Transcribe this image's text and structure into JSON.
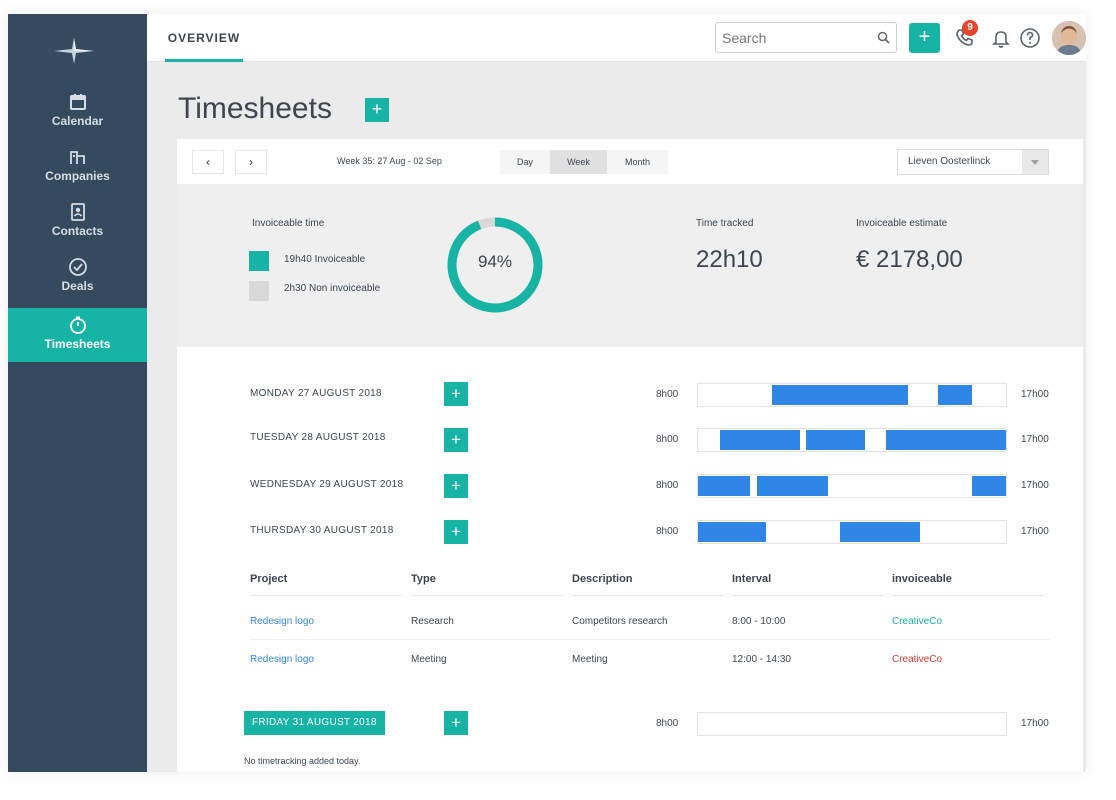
{
  "sidebar": {
    "items": [
      {
        "label": "Calendar",
        "icon": "calendar-icon"
      },
      {
        "label": "Companies",
        "icon": "companies-icon"
      },
      {
        "label": "Contacts",
        "icon": "contacts-icon"
      },
      {
        "label": "Deals",
        "icon": "deals-icon"
      },
      {
        "label": "Timesheets",
        "icon": "stopwatch-icon",
        "active": true
      }
    ]
  },
  "topbar": {
    "tab": "OVERVIEW",
    "search_placeholder": "Search",
    "notifications_count": "9"
  },
  "page": {
    "title": "Timesheets"
  },
  "toolbar": {
    "prev": "‹",
    "next": "›",
    "week_label": "Week 35: 27 Aug - 02 Sep",
    "views": [
      "Day",
      "Week",
      "Month"
    ],
    "active_view": "Week",
    "person": "Lieven Oosterlinck"
  },
  "stats": {
    "invoiceable_time_label": "Invoiceable time",
    "invoiceable": "19h40 Invoiceable",
    "non_invoiceable": "2h30 Non invoiceable",
    "percent_label": "94%",
    "percent_value": 0.94,
    "time_tracked_label": "Time tracked",
    "time_tracked": "22h10",
    "estimate_label": "Invoiceable estimate",
    "estimate": "€ 2178,00",
    "colors": {
      "invoiceable": "#17b3a5",
      "non_invoiceable": "#d8d8d8"
    }
  },
  "days": [
    {
      "label": "MONDAY 27 AUGUST 2018",
      "start": "8h00",
      "end": "17h00",
      "blocks": [
        [
          0.24,
          0.68
        ],
        [
          0.78,
          0.89
        ]
      ]
    },
    {
      "label": "TUESDAY 28 AUGUST 2018",
      "start": "8h00",
      "end": "17h00",
      "blocks": [
        [
          0.07,
          0.33
        ],
        [
          0.35,
          0.54
        ],
        [
          0.61,
          1.0
        ]
      ]
    },
    {
      "label": "WEDNESDAY 29 AUGUST 2018",
      "start": "8h00",
      "end": "17h00",
      "blocks": [
        [
          0.0,
          0.17
        ],
        [
          0.19,
          0.42
        ],
        [
          0.89,
          1.0
        ]
      ]
    },
    {
      "label": "THURSDAY 30 AUGUST 2018",
      "start": "8h00",
      "end": "17h00",
      "blocks": [
        [
          0.0,
          0.22
        ],
        [
          0.46,
          0.72
        ]
      ]
    }
  ],
  "table": {
    "headers": [
      "Project",
      "Type",
      "Description",
      "Interval",
      "invoiceable"
    ],
    "rows": [
      [
        "Redesign logo",
        "Research",
        "Competitors research",
        "8:00 - 10:00",
        "CreativeCo"
      ],
      [
        "Redesign logo",
        "Meeting",
        "Meeting",
        "12:00 - 14:30",
        "CreativeCo"
      ]
    ]
  },
  "friday": {
    "label": "FRIDAY 31 AUGUST 2018",
    "start": "8h00",
    "end": "17h00",
    "note": "No timetracking added today."
  },
  "add_label": "+"
}
